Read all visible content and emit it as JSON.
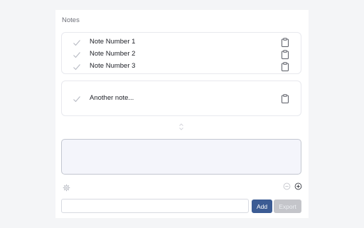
{
  "panel": {
    "title": "Notes"
  },
  "notes": [
    {
      "label": "Note Number 1"
    },
    {
      "label": "Note Number 2"
    },
    {
      "label": "Note Number 3"
    }
  ],
  "notes_group2": [
    {
      "label": "Another note..."
    }
  ],
  "composer": {
    "placeholder": "",
    "value": ""
  },
  "add_field": {
    "placeholder": "",
    "value": ""
  },
  "buttons": {
    "add_label": "Add",
    "export_label": "Export"
  },
  "colors": {
    "accent": "#3c5c94",
    "disabled": "#c4c5ca",
    "check": "#b6b9c2",
    "border": "#e8e9ee"
  },
  "icons": {
    "check": "check-icon",
    "copy": "clipboard-icon",
    "resize": "resize-handle-icon",
    "settings": "gear-icon",
    "minus": "minus-circle-icon",
    "plus": "plus-circle-icon"
  }
}
